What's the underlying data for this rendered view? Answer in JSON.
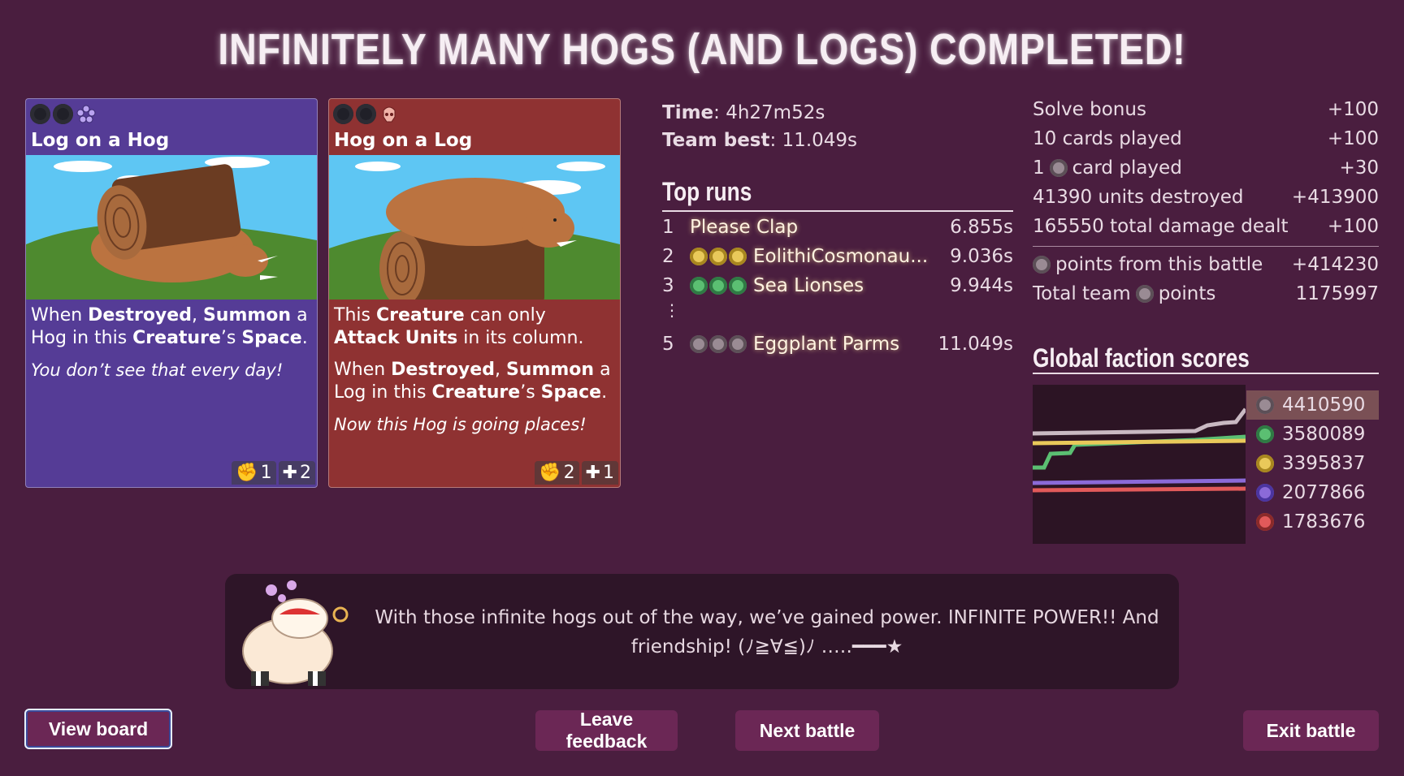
{
  "title": "INFINITELY MANY HOGS (AND LOGS) COMPLETED!",
  "cards": [
    {
      "name": "Log on a Hog",
      "faction_icon": "purple-flower-icon",
      "text_html_parts": {
        "p1a": "When ",
        "p1b": "Destroyed",
        "p1c": ", ",
        "p1d": "Summon",
        "p1e": " a Hog in this ",
        "p1f": "Creature",
        "p1g": "’s ",
        "p1h": "Space",
        "p1i": ".",
        "flavor": "You don’t see that every day!"
      },
      "attack": "1",
      "health": "2"
    },
    {
      "name": "Hog on a Log",
      "faction_icon": "red-skull-icon",
      "text_html_parts": {
        "p1a": "This ",
        "p1b": "Creature",
        "p1c": " can only ",
        "p1d": "Attack",
        "p1e": " ",
        "p1f": "Units",
        "p1g": " in its column.",
        "p2a": "When ",
        "p2b": "Destroyed",
        "p2c": ", ",
        "p2d": "Summon",
        "p2e": " a Log in this ",
        "p2f": "Creature",
        "p2g": "’s ",
        "p2h": "Space",
        "p2i": ".",
        "flavor": "Now this Hog is going places!"
      },
      "attack": "2",
      "health": "1"
    }
  ],
  "time": {
    "label": "Time",
    "value": "4h27m52s"
  },
  "team_best": {
    "label": "Team best",
    "value": "11.049s"
  },
  "top_runs": {
    "heading": "Top runs",
    "rows": [
      {
        "rank": "1",
        "icons": [],
        "name": "Please Clap",
        "time": "6.855s"
      },
      {
        "rank": "2",
        "icons": [
          "gold",
          "gold",
          "gold"
        ],
        "name": "EolithiCosmonau...",
        "time": "9.036s"
      },
      {
        "rank": "3",
        "icons": [
          "green",
          "green",
          "green"
        ],
        "name": "Sea Lionses",
        "time": "9.944s"
      },
      {
        "rank": "5",
        "icons": [
          "grey",
          "grey",
          "grey"
        ],
        "name": "Eggplant Parms",
        "time": "11.049s"
      }
    ],
    "ellipsis": "⋮"
  },
  "bonuses": [
    {
      "label": "Solve bonus",
      "value": "+100"
    },
    {
      "label": "10 cards played",
      "value": "+100"
    },
    {
      "label_pre": "1",
      "label_post": "card played",
      "value": "+30"
    },
    {
      "label": "41390 units destroyed",
      "value": "+413900"
    },
    {
      "label": "165550 total damage dealt",
      "value": "+100"
    }
  ],
  "points_battle": {
    "label": "points from this battle",
    "value": "+414230"
  },
  "total_points": {
    "label_pre": "Total team",
    "label_post": "points",
    "value": "1175997"
  },
  "global": {
    "heading": "Global faction scores",
    "scores": [
      {
        "faction": "grey",
        "value": "4410590"
      },
      {
        "faction": "green",
        "value": "3580089"
      },
      {
        "faction": "gold",
        "value": "3395837"
      },
      {
        "faction": "purple",
        "value": "2077866"
      },
      {
        "faction": "red",
        "value": "1783676"
      }
    ]
  },
  "colors": {
    "grey": "#c9b9c2",
    "green": "#5bbf72",
    "gold": "#e9c95a",
    "purple": "#8b6ad8",
    "red": "#e25a5a"
  },
  "dialog": {
    "text": "With those infinite hogs out of the way, we’ve gained power. INFINITE POWER!! And friendship! (ﾉ≧∀≦)ﾉ ‥…━━━★"
  },
  "buttons": {
    "view_board": "View board",
    "leave_feedback": "Leave feedback",
    "next_battle": "Next battle",
    "exit_battle": "Exit battle"
  }
}
